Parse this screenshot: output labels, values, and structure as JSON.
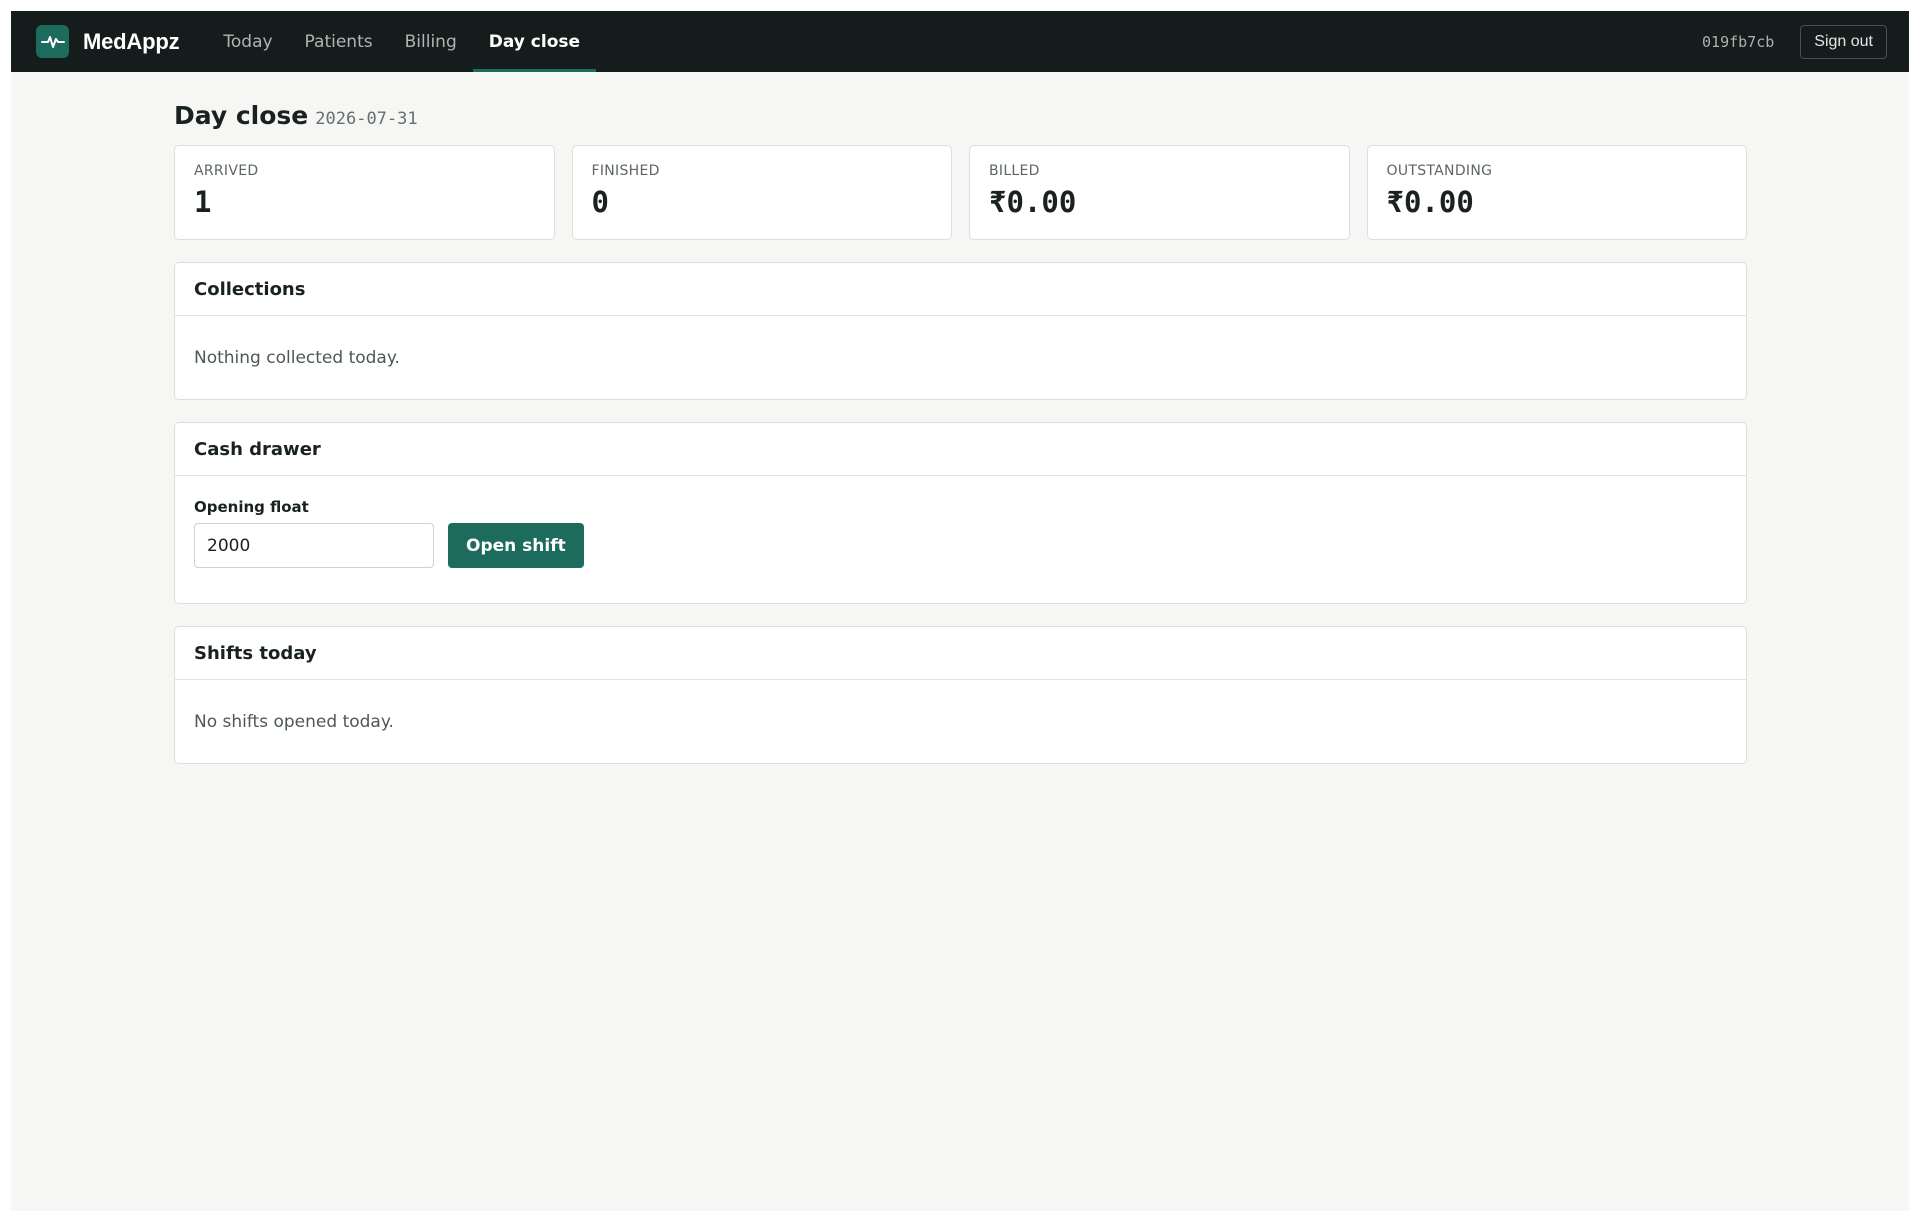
{
  "app": {
    "name": "MedAppz",
    "logo_icon": "pulse-icon",
    "accent": "#1c6b5c"
  },
  "nav": {
    "items": [
      {
        "label": "Today"
      },
      {
        "label": "Patients"
      },
      {
        "label": "Billing"
      },
      {
        "label": "Day close"
      }
    ],
    "active": "Day close"
  },
  "session": {
    "id": "019fb7cb",
    "signout_label": "Sign out"
  },
  "page": {
    "title": "Day close",
    "date": "2026-07-31"
  },
  "stats": [
    {
      "label": "ARRIVED",
      "value": "1"
    },
    {
      "label": "FINISHED",
      "value": "0"
    },
    {
      "label": "BILLED",
      "value": "₹0.00"
    },
    {
      "label": "OUTSTANDING",
      "value": "₹0.00"
    }
  ],
  "collections": {
    "title": "Collections",
    "empty_text": "Nothing collected today."
  },
  "cash_drawer": {
    "title": "Cash drawer",
    "opening_float_label": "Opening float",
    "opening_float_value": "2000",
    "open_button_label": "Open shift"
  },
  "shifts": {
    "title": "Shifts today",
    "empty_text": "No shifts opened today."
  }
}
